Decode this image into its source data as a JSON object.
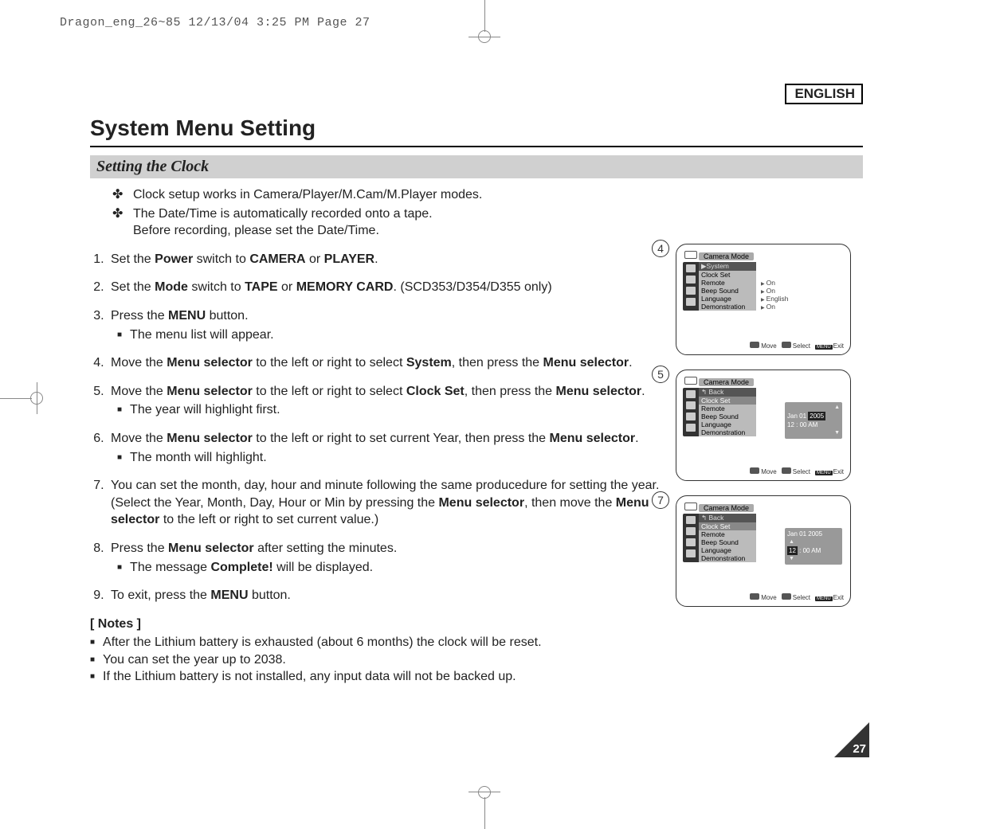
{
  "print_header": "Dragon_eng_26~85  12/13/04  3:25 PM  Page 27",
  "lang_label": "ENGLISH",
  "title": "System Menu Setting",
  "subhead": "Setting the Clock",
  "dagger_items": [
    {
      "text": "Clock setup works in Camera/Player/M.Cam/M.Player modes."
    },
    {
      "text": "The Date/Time is automatically recorded onto a tape."
    }
  ],
  "dagger_sub": "Before recording, please set the Date/Time.",
  "steps": {
    "s1_pre": "Set the ",
    "s1_b1": "Power",
    "s1_mid": " switch to ",
    "s1_b2": "CAMERA",
    "s1_or": " or ",
    "s1_b3": "PLAYER",
    "s1_end": ".",
    "s2_pre": "Set the ",
    "s2_b1": "Mode",
    "s2_mid": " switch to ",
    "s2_b2": "TAPE",
    "s2_or": " or ",
    "s2_b3": "MEMORY CARD",
    "s2_end": ". (SCD353/D354/D355 only)",
    "s3_pre": "Press the ",
    "s3_b1": "MENU",
    "s3_end": " button.",
    "s3_sub": "The menu list will appear.",
    "s4_pre": "Move the ",
    "s4_b1": "Menu selector",
    "s4_mid": " to the left or right to select ",
    "s4_b2": "System",
    "s4_mid2": ", then press the ",
    "s4_b3": "Menu selector",
    "s4_end": ".",
    "s5_pre": "Move the ",
    "s5_b1": "Menu selector",
    "s5_mid": " to the left or right to select ",
    "s5_b2": "Clock Set",
    "s5_mid2": ", then press the ",
    "s5_b3": "Menu selector",
    "s5_end": ".",
    "s5_sub": "The year will highlight first.",
    "s6_pre": "Move the ",
    "s6_b1": "Menu selector",
    "s6_mid": " to the left or right to set current Year, then press the ",
    "s6_b2": "Menu selector",
    "s6_end": ".",
    "s6_sub": "The month will highlight.",
    "s7_line1": "You can set the month, day, hour and minute following the same producedure for setting the year.",
    "s7_line2_pre": "(Select the Year, Month, Day, Hour or Min by pressing the ",
    "s7_line2_b1": "Menu selector",
    "s7_line2_mid": ", then move the ",
    "s7_line2_b2": "Menu selector",
    "s7_line2_end": " to the left or right to set current value.)",
    "s8_pre": "Press the ",
    "s8_b1": "Menu selector",
    "s8_end": " after setting the minutes.",
    "s8_sub_pre": "The message ",
    "s8_sub_b": "Complete!",
    "s8_sub_end": " will be displayed.",
    "s9_pre": "To exit, press the ",
    "s9_b1": "MENU",
    "s9_end": " button."
  },
  "notes_head": "[ Notes ]",
  "notes": [
    "After the Lithium battery is exhausted (about 6 months) the clock will be reset.",
    "You can set the year up to 2038.",
    "If the Lithium battery is not installed, any input data  will not be backed up."
  ],
  "screens": {
    "footer_move": "Move",
    "footer_select": "Select",
    "footer_menu": "MENU",
    "footer_exit": "Exit",
    "s4": {
      "step": "4",
      "title": "Camera Mode",
      "head": "▶System",
      "items": [
        {
          "label": "Clock Set",
          "val": ""
        },
        {
          "label": "Remote",
          "val": "On"
        },
        {
          "label": "Beep Sound",
          "val": "On"
        },
        {
          "label": "Language",
          "val": "English"
        },
        {
          "label": "Demonstration",
          "val": "On"
        }
      ]
    },
    "s5": {
      "step": "5",
      "title": "Camera Mode",
      "back": "Back",
      "items": [
        {
          "label": "Clock Set",
          "hl": true
        },
        {
          "label": "Remote"
        },
        {
          "label": "Beep Sound"
        },
        {
          "label": "Language"
        },
        {
          "label": "Demonstration"
        }
      ],
      "date_line1_pre": "Jan  01 ",
      "date_line1_hl": "2005",
      "date_line2": "12 : 00  AM"
    },
    "s7": {
      "step": "7",
      "title": "Camera Mode",
      "back": "Back",
      "items": [
        {
          "label": "Clock Set",
          "hl": true
        },
        {
          "label": "Remote"
        },
        {
          "label": "Beep Sound"
        },
        {
          "label": "Language"
        },
        {
          "label": "Demonstration"
        }
      ],
      "date_line1": "Jan  01  2005",
      "date_line2_hl": "12",
      "date_line2_rest": " : 00  AM"
    }
  },
  "page_number": "27"
}
